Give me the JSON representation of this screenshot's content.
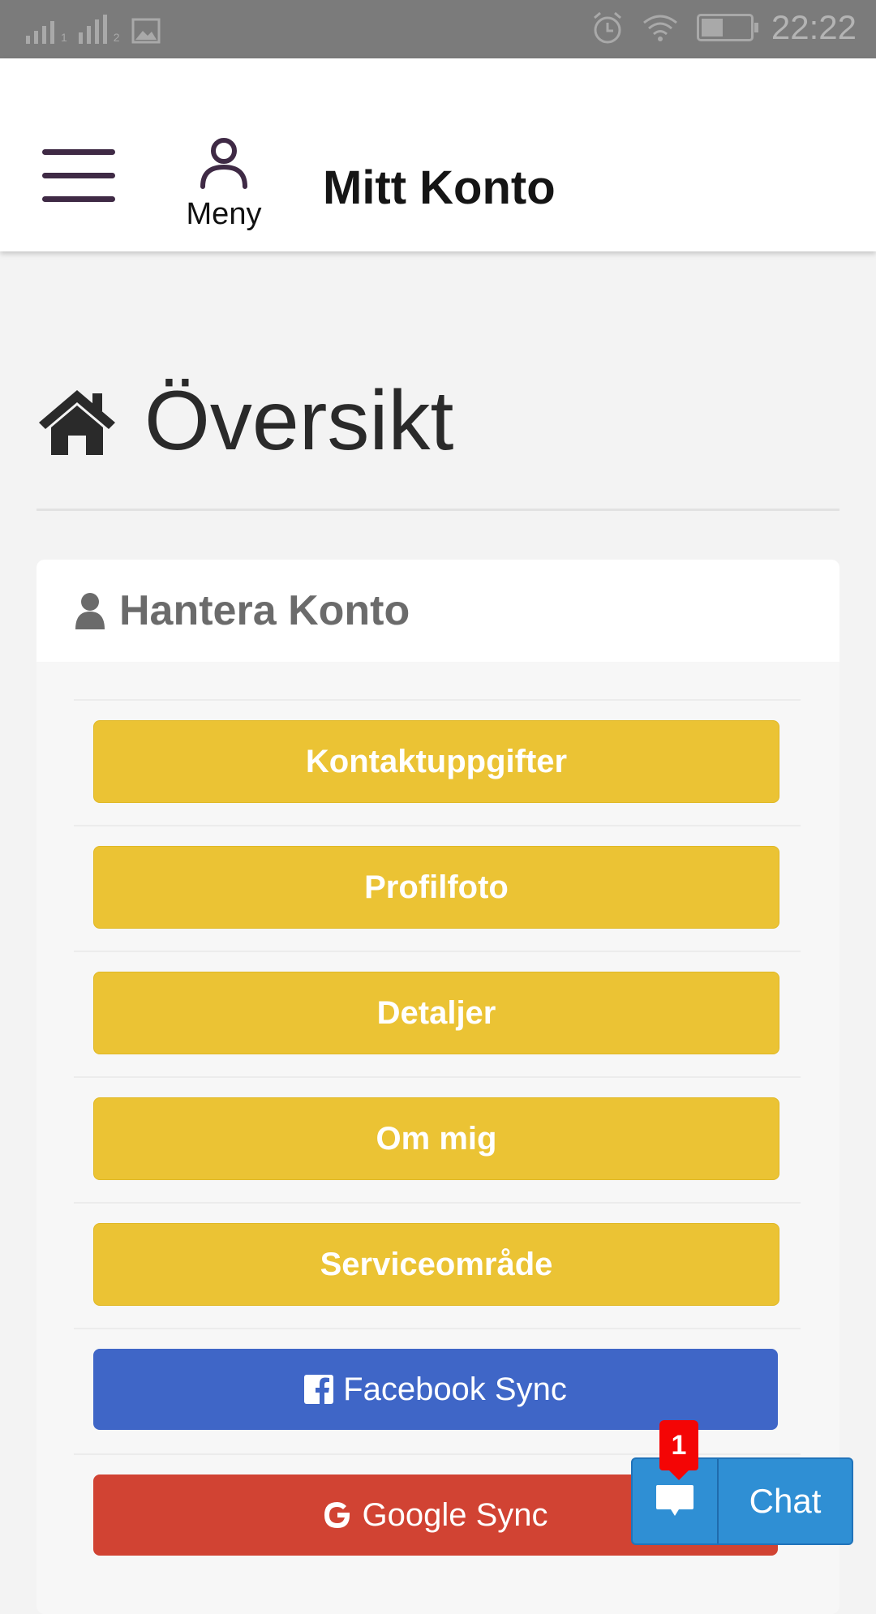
{
  "status_bar": {
    "time": "22:22"
  },
  "header": {
    "menu_label": "Meny",
    "title": "Mitt Konto"
  },
  "overview": {
    "title": "Översikt"
  },
  "panel": {
    "title": "Hantera Konto",
    "buttons": [
      {
        "label": "Kontaktuppgifter"
      },
      {
        "label": "Profilfoto"
      },
      {
        "label": "Detaljer"
      },
      {
        "label": "Om mig"
      },
      {
        "label": "Serviceområde"
      },
      {
        "label": "Facebook Sync",
        "icon": "facebook-icon"
      },
      {
        "label": "Google Sync",
        "icon": "google-icon"
      }
    ]
  },
  "chat": {
    "label": "Chat",
    "badge": "1"
  },
  "colors": {
    "yellow": "#ebc334",
    "facebook": "#3f66c7",
    "google": "#d14333",
    "chat": "#2f8fd4",
    "badge": "#f40505"
  }
}
